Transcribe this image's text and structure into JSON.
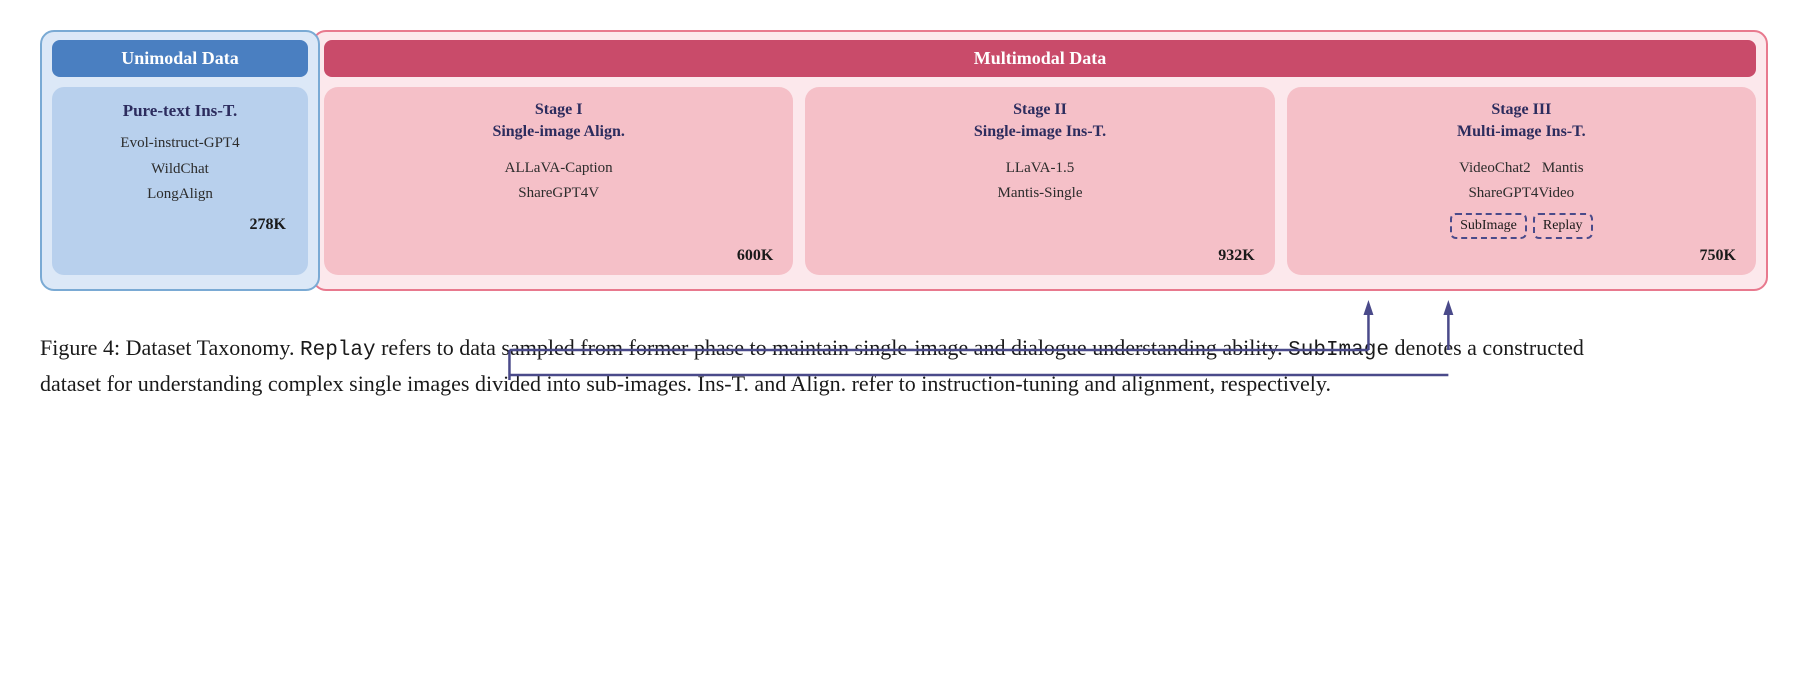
{
  "diagram": {
    "unimodal": {
      "header": "Unimodal Data",
      "inner_title": "Pure-text Ins-T.",
      "items": [
        "Evol-instruct-GPT4",
        "WildChat",
        "LongAlign"
      ],
      "count": "278K"
    },
    "multimodal": {
      "header": "Multimodal Data",
      "stages": [
        {
          "title": "Stage I\nSingle-image Align.",
          "items": [
            "ALLaVA-Caption",
            "ShareGPT4V"
          ],
          "count": "600K"
        },
        {
          "title": "Stage II\nSingle-image Ins-T.",
          "items": [
            "LLaVA-1.5",
            "Mantis-Single"
          ],
          "count": "932K"
        },
        {
          "title": "Stage III\nMulti-image Ins-T.",
          "items_top": [
            "VideoChat2",
            "Mantis"
          ],
          "items_mid": "ShareGPT4Video",
          "box1": "SubImage",
          "box2": "Replay",
          "count": "750K"
        }
      ]
    }
  },
  "caption": {
    "label": "Figure 4:",
    "text_parts": [
      " Dataset Taxonomy. ",
      "Replay",
      " refers to data sampled from former phase to maintain single-image and dialogue understanding ability. ",
      "SubImage",
      " denotes a constructed dataset for understanding complex single images divided into sub-images.  Ins-T. and Align.  refer to instruction-tuning and alignment, respectively."
    ]
  }
}
